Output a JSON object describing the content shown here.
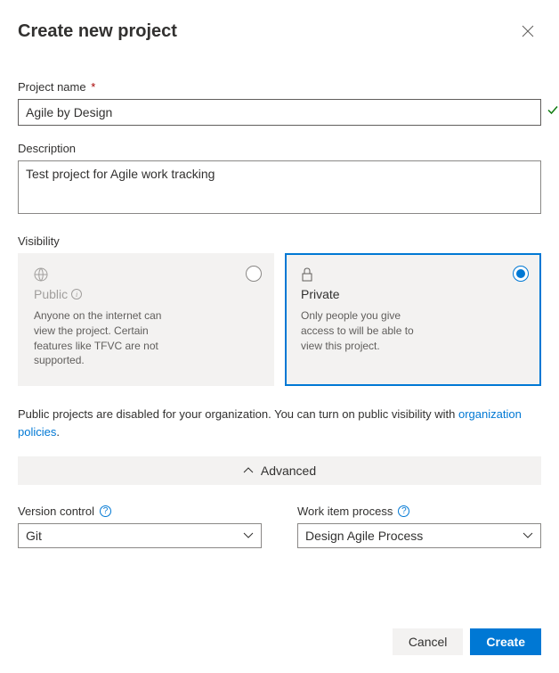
{
  "dialog": {
    "title": "Create new project"
  },
  "fields": {
    "projectName": {
      "label": "Project name",
      "required": "*",
      "value": "Agile by Design"
    },
    "description": {
      "label": "Description",
      "value": "Test project for Agile work tracking"
    }
  },
  "visibility": {
    "label": "Visibility",
    "public": {
      "title": "Public",
      "desc": "Anyone on the internet can view the project. Certain features like TFVC are not supported."
    },
    "private": {
      "title": "Private",
      "desc": "Only people you give access to will be able to view this project."
    },
    "note_prefix": "Public projects are disabled for your organization. You can turn on public visibility with ",
    "note_link": "organization policies",
    "note_suffix": "."
  },
  "advanced": {
    "label": "Advanced"
  },
  "versionControl": {
    "label": "Version control",
    "value": "Git"
  },
  "workItemProcess": {
    "label": "Work item process",
    "value": "Design Agile Process"
  },
  "footer": {
    "cancel": "Cancel",
    "create": "Create"
  }
}
